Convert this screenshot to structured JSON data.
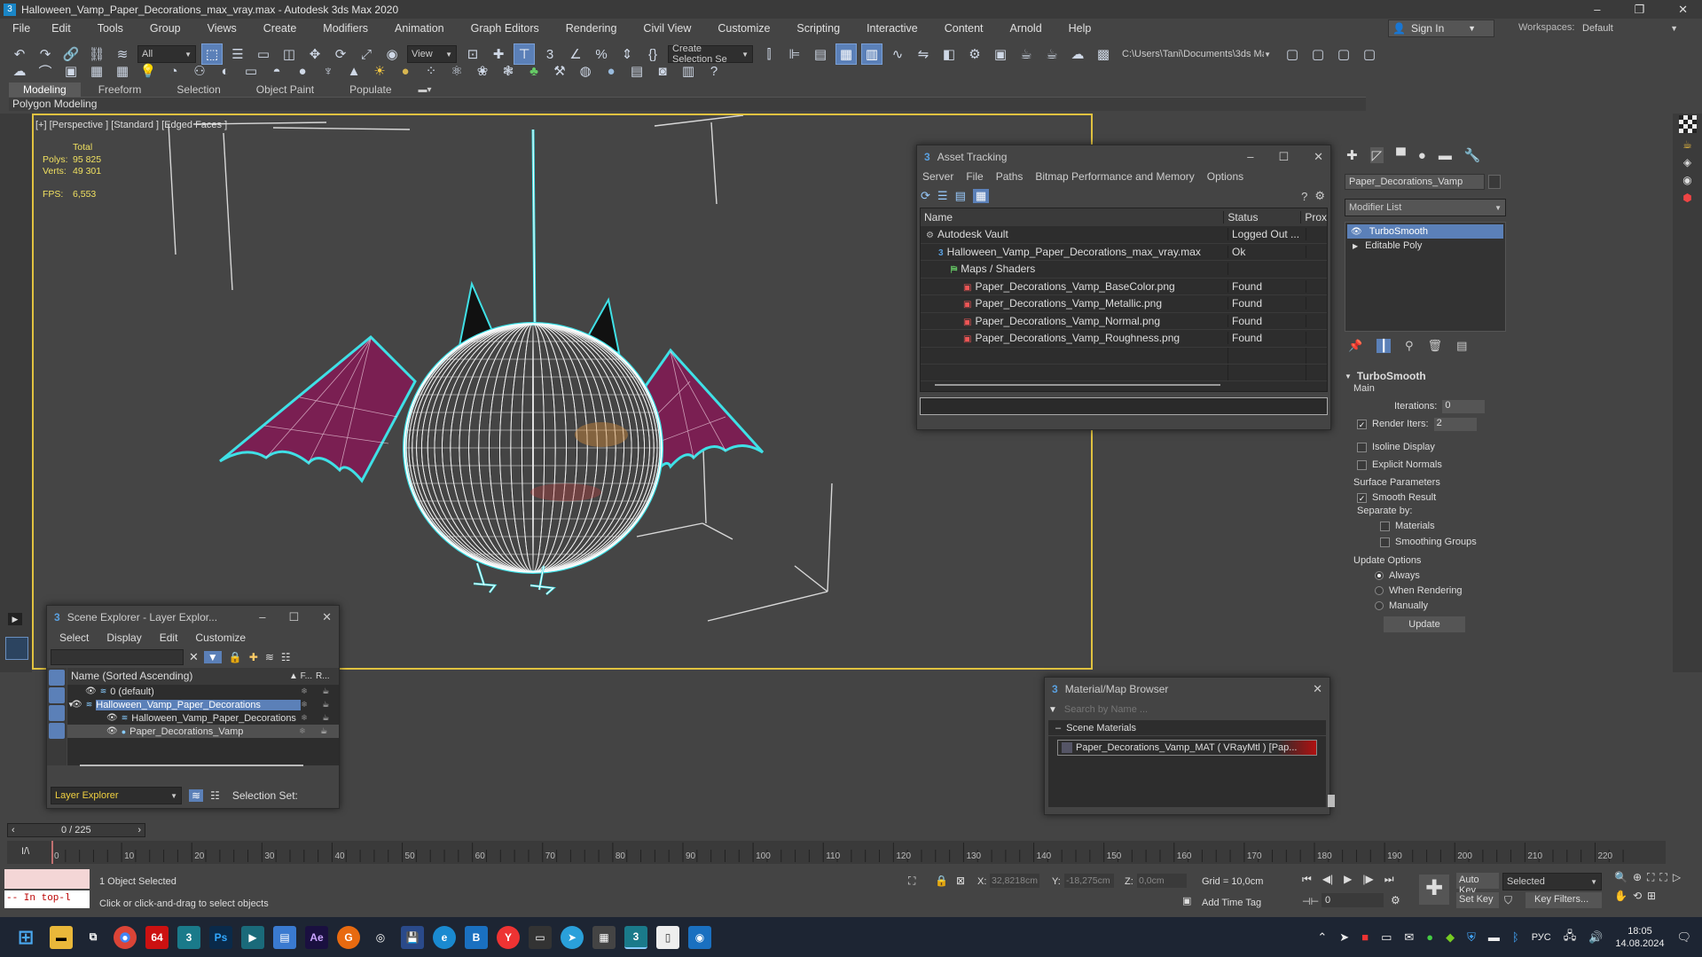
{
  "app": {
    "title": "Halloween_Vamp_Paper_Decorations_max_vray.max - Autodesk 3ds Max 2020",
    "menu": [
      "File",
      "Edit",
      "Tools",
      "Group",
      "Views",
      "Create",
      "Modifiers",
      "Animation",
      "Graph Editors",
      "Rendering",
      "Civil View",
      "Customize",
      "Scripting",
      "Interactive",
      "Content",
      "Arnold",
      "Help"
    ],
    "sign_in": "Sign In",
    "workspaces_label": "Workspaces:",
    "workspace": "Default"
  },
  "toolbar": {
    "filter": "All",
    "view": "View",
    "selection_set": "Create Selection Se",
    "project_path": "C:\\Users\\Tani\\Documents\\3ds Max 2020"
  },
  "ribbon": {
    "tabs": [
      "Modeling",
      "Freeform",
      "Selection",
      "Object Paint",
      "Populate"
    ],
    "sub": "Polygon Modeling"
  },
  "viewport": {
    "label": "[+] [Perspective ] [Standard ] [Edged Faces ]",
    "stats_total": "Total",
    "polys_label": "Polys:",
    "polys": "95 825",
    "verts_label": "Verts:",
    "verts": "49 301",
    "fps_label": "FPS:",
    "fps": "6,553"
  },
  "asset_tracking": {
    "title": "Asset Tracking",
    "menu": [
      "Server",
      "File",
      "Paths",
      "Bitmap Performance and Memory",
      "Options"
    ],
    "cols": [
      "Name",
      "Status",
      "Prox"
    ],
    "rows": [
      {
        "name": "Autodesk Vault",
        "status": "Logged Out ...",
        "indent": 0,
        "icon": "vault-icon"
      },
      {
        "name": "Halloween_Vamp_Paper_Decorations_max_vray.max",
        "status": "Ok",
        "indent": 1,
        "icon": "max-file-icon"
      },
      {
        "name": "Maps / Shaders",
        "status": "",
        "indent": 2,
        "icon": "maps-icon"
      },
      {
        "name": "Paper_Decorations_Vamp_BaseColor.png",
        "status": "Found",
        "indent": 3,
        "icon": "png-icon"
      },
      {
        "name": "Paper_Decorations_Vamp_Metallic.png",
        "status": "Found",
        "indent": 3,
        "icon": "png-icon"
      },
      {
        "name": "Paper_Decorations_Vamp_Normal.png",
        "status": "Found",
        "indent": 3,
        "icon": "png-icon"
      },
      {
        "name": "Paper_Decorations_Vamp_Roughness.png",
        "status": "Found",
        "indent": 3,
        "icon": "png-icon"
      }
    ]
  },
  "scene_explorer": {
    "title": "Scene Explorer - Layer Explor...",
    "menu": [
      "Select",
      "Display",
      "Edit",
      "Customize"
    ],
    "col_name": "Name (Sorted Ascending)",
    "col_f": "▲ F...",
    "col_r": "R...",
    "rows": [
      {
        "name": "0 (default)",
        "indent": 0,
        "selected": false
      },
      {
        "name": "Halloween_Vamp_Paper_Decorations",
        "indent": 0,
        "selected": true
      },
      {
        "name": "Halloween_Vamp_Paper_Decorations",
        "indent": 1,
        "selected": false
      },
      {
        "name": "Paper_Decorations_Vamp",
        "indent": 1,
        "selected": false
      }
    ],
    "explorer": "Layer Explorer",
    "selection_set": "Selection Set:"
  },
  "material_browser": {
    "title": "Material/Map Browser",
    "search": "Search by Name ...",
    "section": "Scene Materials",
    "item": "Paper_Decorations_Vamp_MAT ( VRayMtl ) [Pap..."
  },
  "command_panel": {
    "object_name": "Paper_Decorations_Vamp",
    "modifier_list": "Modifier List",
    "stack": [
      "TurboSmooth",
      "Editable Poly"
    ],
    "rollout": "TurboSmooth",
    "main": "Main",
    "iterations_label": "Iterations:",
    "iterations": "0",
    "render_iters_label": "Render Iters:",
    "render_iters": "2",
    "isoline": "Isoline Display",
    "explicit_normals": "Explicit Normals",
    "surface_params": "Surface Parameters",
    "smooth_result": "Smooth Result",
    "separate_by": "Separate by:",
    "materials": "Materials",
    "smoothing_groups": "Smoothing Groups",
    "update_options": "Update Options",
    "always": "Always",
    "when_rendering": "When Rendering",
    "manually": "Manually",
    "update_btn": "Update"
  },
  "timeline": {
    "frame": "0 / 225",
    "ticks": [
      "0",
      "10",
      "20",
      "30",
      "40",
      "50",
      "60",
      "70",
      "80",
      "90",
      "100",
      "110",
      "120",
      "130",
      "140",
      "150",
      "160",
      "170",
      "180",
      "190",
      "200",
      "210",
      "220"
    ],
    "progress": 0
  },
  "status": {
    "script": "-- In top-l",
    "selected": "1 Object Selected",
    "prompt": "Click or click-and-drag to select objects",
    "x_label": "X:",
    "x": "32,8218cm",
    "y_label": "Y:",
    "y": "-18,275cm",
    "z_label": "Z:",
    "z": "0,0cm",
    "grid": "Grid = 10,0cm",
    "add_time_tag": "Add Time Tag",
    "frame": "0",
    "auto_key": "Auto Key",
    "set_key": "Set Key",
    "key_mode": "Selected",
    "key_filters": "Key Filters..."
  },
  "taskbar": {
    "lang": "РУС",
    "time": "18:05",
    "date": "14.08.2024"
  },
  "colors": {
    "selection_cyan": "#3fe0e6",
    "wing_fill": "#7a1f52",
    "accent_blue": "#5b80b8"
  }
}
